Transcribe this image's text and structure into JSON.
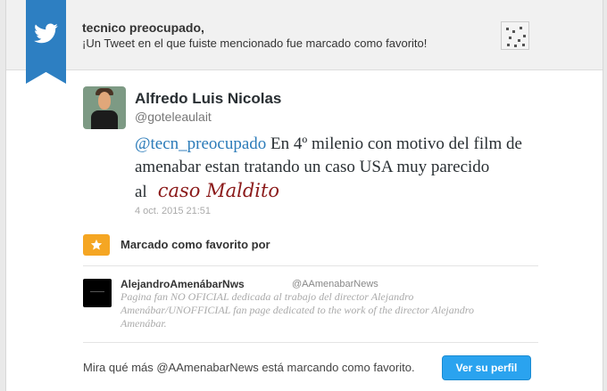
{
  "notification": {
    "title": "tecnico preocupado,",
    "subtitle": "¡Un Tweet en el que fuiste mencionado fue marcado como favorito!"
  },
  "tweet": {
    "author_name": "Alfredo Luis Nicolas",
    "author_handle": "@goteleaulait",
    "mention": "@tecn_preocupado",
    "text": " En 4º milenio con motivo del film de amenabar estan tratando un caso USA muy parecido al",
    "handwritten": "caso Maldito",
    "date": "4 oct. 2015 21:51"
  },
  "favorited": {
    "label": "Marcado como favorito por",
    "user_name": "AlejandroAmenábarNws",
    "user_handle": "@AAmenabarNews",
    "user_bio": "Pagina fan NO OFICIAL dedicada al trabajo del director Alejandro Amenábar/UNOFFICIAL fan page dedicated to the work of the director Alejandro Amenábar."
  },
  "footer": {
    "text": "Mira qué más @AAmenabarNews está marcando como favorito.",
    "button_label": "Ver su perfil"
  },
  "colors": {
    "ribbon": "#2d7fc2",
    "link": "#2b7bb9",
    "star": "#f5a623",
    "button": "#2aa3ef"
  }
}
